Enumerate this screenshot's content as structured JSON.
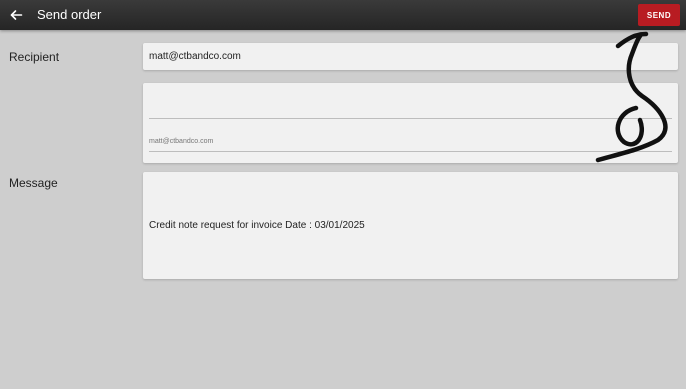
{
  "appbar": {
    "back_icon": "arrow-left-icon",
    "title": "Send order",
    "send_label": "SEND",
    "send_color": "#b81c22"
  },
  "recipient": {
    "label": "Recipient",
    "value": "matt@ctbandco.com",
    "cc_value": "",
    "bcc_value": "matt@ctbandco.com"
  },
  "message": {
    "label": "Message",
    "body": "Credit note request for invoice Date : 03/01/2025"
  },
  "annotation": {
    "icon": "hand-drawn-arrow-icon",
    "color": "#111111"
  }
}
